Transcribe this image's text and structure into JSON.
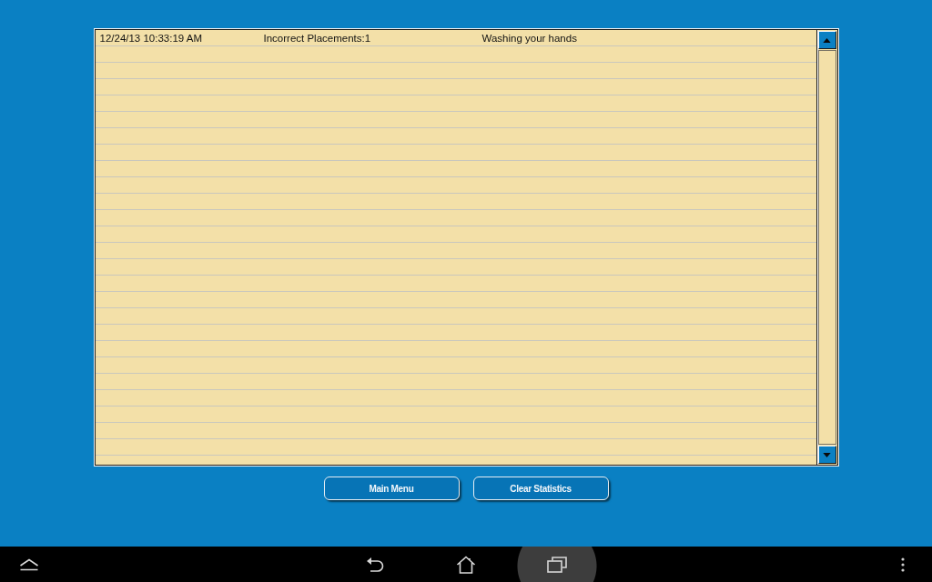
{
  "log": {
    "rows": [
      {
        "cells": [
          "12/24/13 10:33:19 AM",
          "Incorrect Placements:1",
          "Washing your hands"
        ]
      }
    ]
  },
  "buttons": [
    "Main Menu",
    "Clear Statistics"
  ],
  "nav_bar": {
    "buttons": [
      {
        "kind": "up",
        "selected": false
      },
      {
        "kind": "back",
        "selected": false
      },
      {
        "kind": "home",
        "selected": false
      },
      {
        "kind": "recents",
        "selected": true
      },
      {
        "kind": "menu",
        "selected": false
      }
    ]
  }
}
